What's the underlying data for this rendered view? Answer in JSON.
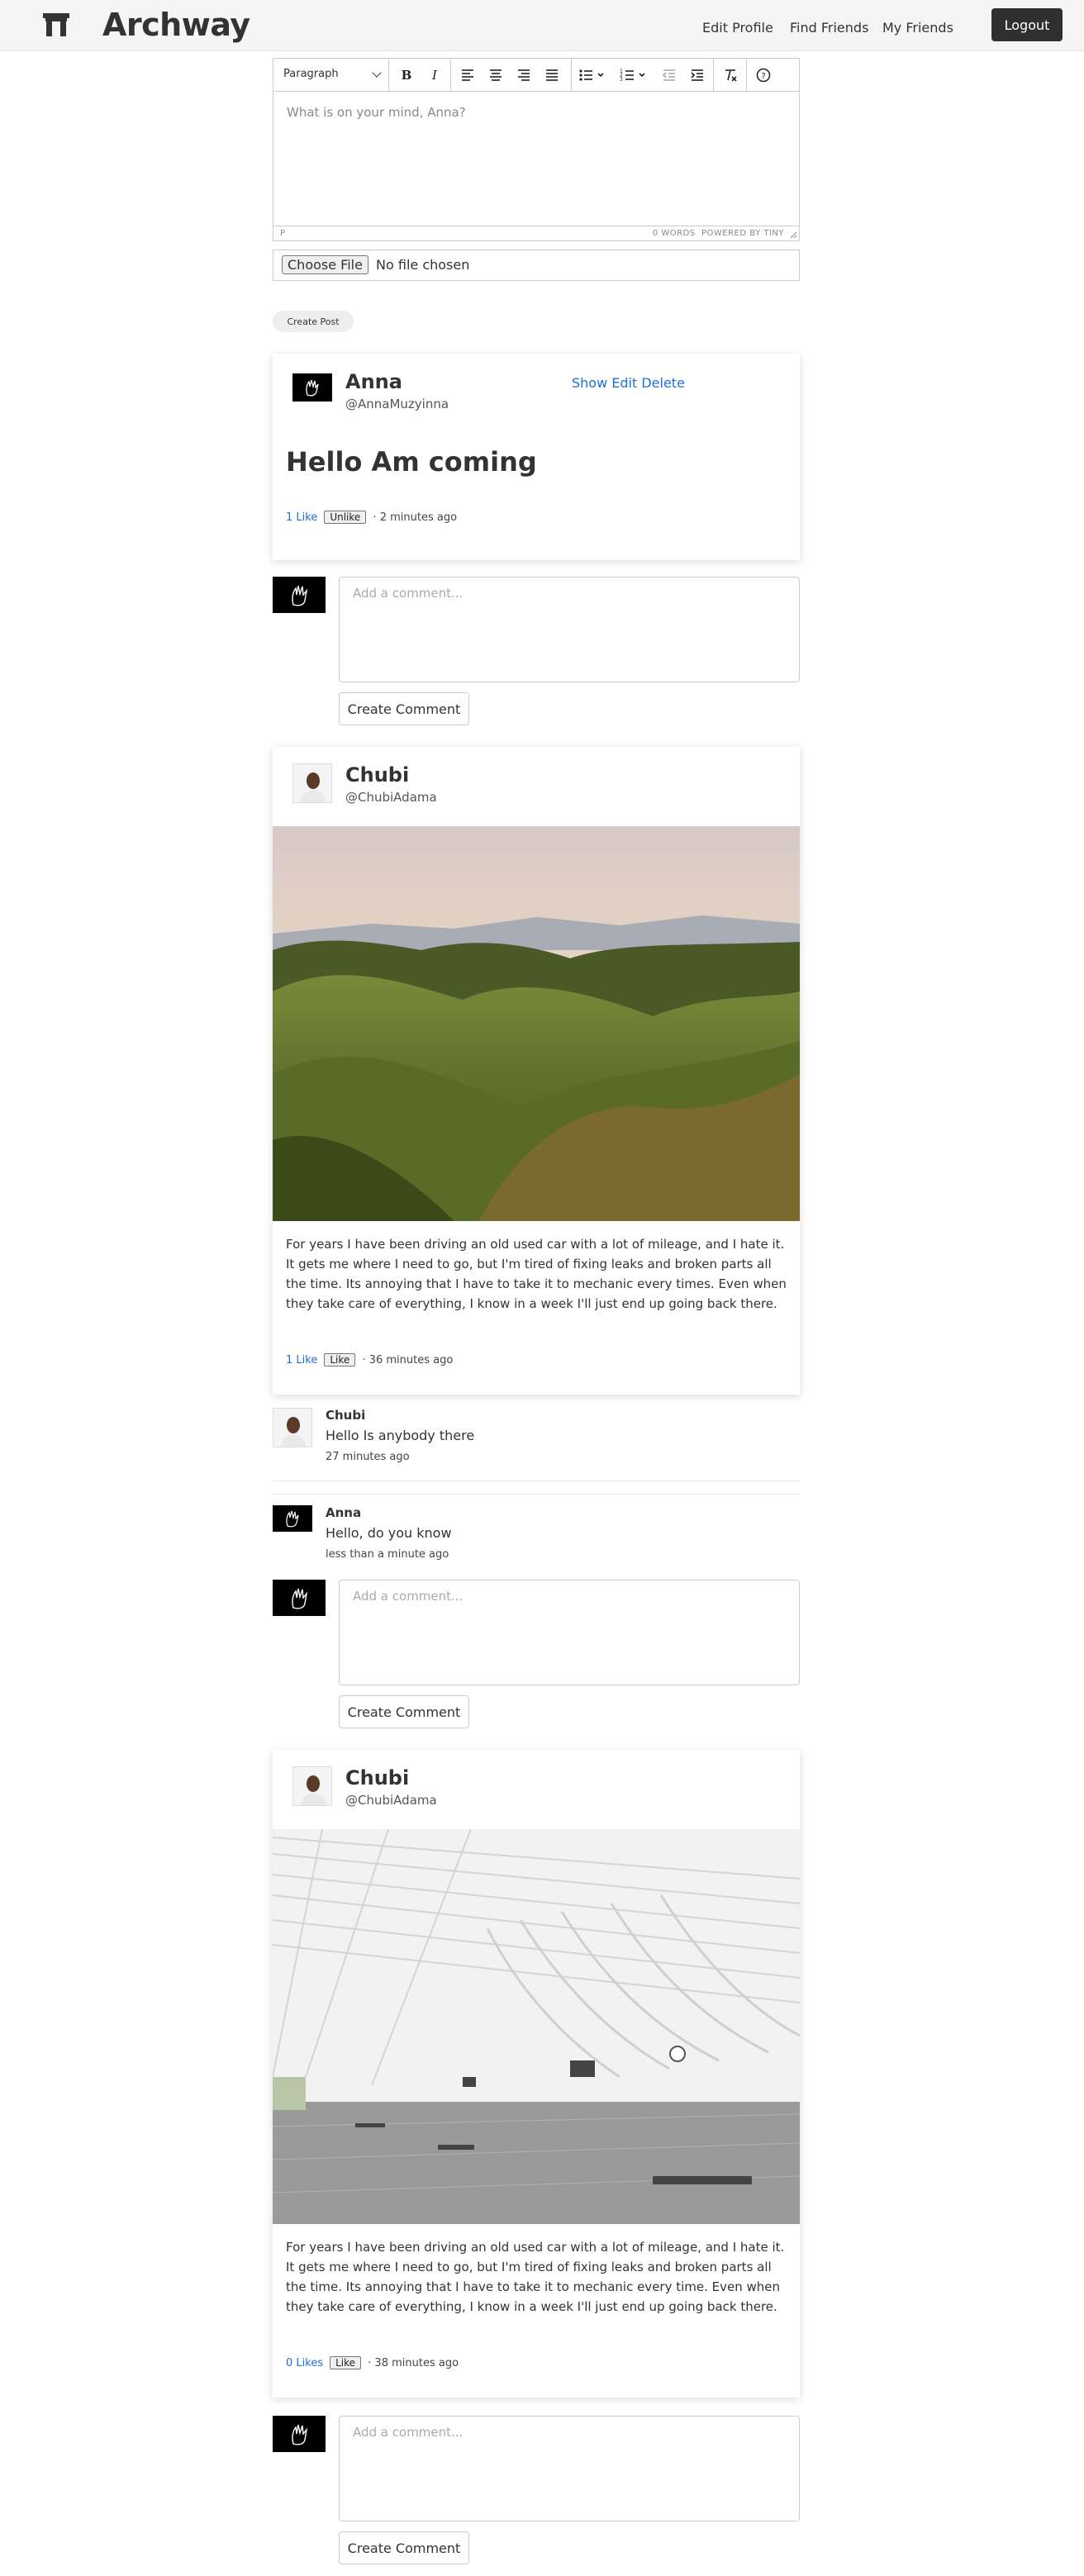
{
  "navbar": {
    "brand": "Archway",
    "links": [
      "Edit Profile",
      "Find Friends",
      "My Friends"
    ],
    "logout": "Logout"
  },
  "editor": {
    "block_format": "Paragraph",
    "placeholder": "What is on your mind, Anna?",
    "status_path": "P",
    "status_words": "0 WORDS",
    "status_powered": "POWERED BY TINY"
  },
  "file_input": {
    "button": "Choose File",
    "status": "No file chosen"
  },
  "create_post_label": "Create Post",
  "comment_form": {
    "placeholder": "Add a comment...",
    "submit_label": "Create Comment"
  },
  "posts": [
    {
      "author": "Anna",
      "handle": "@AnnaMuzyinna",
      "actions": [
        "Show",
        "Edit",
        "Delete"
      ],
      "title": "Hello Am coming",
      "likes": "1 Like",
      "like_button": "Unlike",
      "time": "· 2 minutes ago"
    },
    {
      "author": "Chubi",
      "handle": "@ChubiAdama",
      "body": "For years I have been driving an old used car with a lot of mileage, and I hate it. It gets me where I need to go, but I'm tired of fixing leaks and broken parts all the time. Its annoying that I have to take it to mechanic every times. Even when they take care of everything, I know in a week I'll just end up going back there.",
      "likes": "1 Like",
      "like_button": "Like",
      "time": "· 36 minutes ago",
      "comments": [
        {
          "author": "Chubi",
          "text": "Hello Is anybody there",
          "time": "27 minutes ago"
        },
        {
          "author": "Anna",
          "text": "Hello, do you know",
          "time": "less than a minute ago"
        }
      ]
    },
    {
      "author": "Chubi",
      "handle": "@ChubiAdama",
      "body": "For years I have been driving an old used car with a lot of mileage, and I hate it. It gets me where I need to go, but I'm tired of fixing leaks and broken parts all the time. Its annoying that I have to take it to mechanic every time. Even when they take care of everything, I know in a week I'll just end up going back there.",
      "likes": "0 Likes",
      "like_button": "Like",
      "time": "· 38 minutes ago"
    }
  ]
}
